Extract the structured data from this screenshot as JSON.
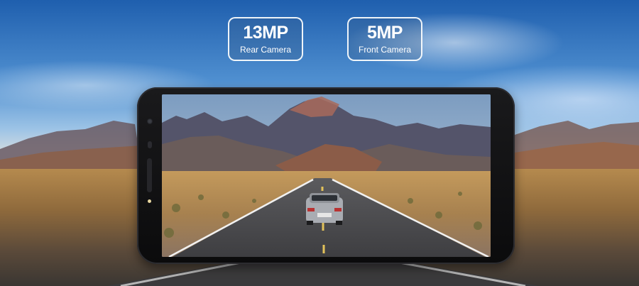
{
  "badges": [
    {
      "value": "13MP",
      "label": "Rear Camera"
    },
    {
      "value": "5MP",
      "label": "Front Camera"
    }
  ]
}
